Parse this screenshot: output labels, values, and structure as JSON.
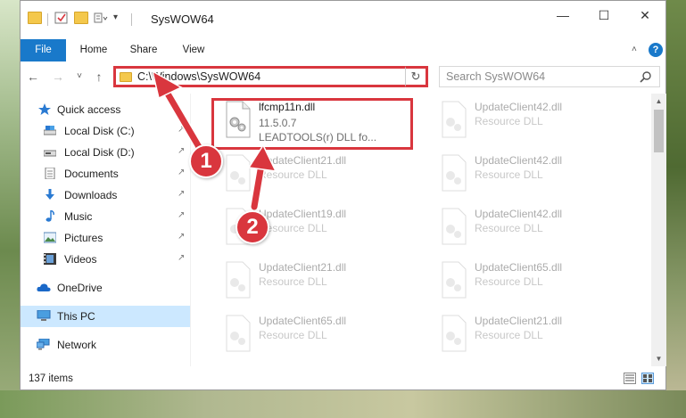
{
  "window": {
    "title": "SysWOW64",
    "minimize": "—",
    "maximize": "☐",
    "close": "✕"
  },
  "ribbon": {
    "tabs": [
      "File",
      "Home",
      "Share",
      "View"
    ],
    "expand": "˄",
    "help": "?"
  },
  "navigation": {
    "back": "←",
    "forward": "→",
    "recent": "˅",
    "up": "↑",
    "address": "C:\\Windows\\SysWOW64",
    "address_dropdown": "˅",
    "refresh": "↻",
    "search_placeholder": "Search SysWOW64"
  },
  "sidebar": {
    "items": [
      {
        "label": "Quick access",
        "icon": "star-icon",
        "pinned": false
      },
      {
        "label": "Local Disk (C:)",
        "icon": "drive-icon",
        "pinned": true
      },
      {
        "label": "Local Disk (D:)",
        "icon": "drive-icon",
        "pinned": true
      },
      {
        "label": "Documents",
        "icon": "documents-icon",
        "pinned": true
      },
      {
        "label": "Downloads",
        "icon": "download-icon",
        "pinned": true
      },
      {
        "label": "Music",
        "icon": "music-icon",
        "pinned": true
      },
      {
        "label": "Pictures",
        "icon": "pictures-icon",
        "pinned": true
      },
      {
        "label": "Videos",
        "icon": "videos-icon",
        "pinned": true
      },
      {
        "label": "OneDrive",
        "icon": "cloud-icon",
        "pinned": false
      },
      {
        "label": "This PC",
        "icon": "computer-icon",
        "pinned": false,
        "selected": true
      },
      {
        "label": "Network",
        "icon": "network-icon",
        "pinned": false
      }
    ],
    "pin_glyph": "↗"
  },
  "files": [
    {
      "name": "lfcmp11n.dll",
      "line2": "11.5.0.7",
      "line3": "LEADTOOLS(r) DLL fo...",
      "highlighted": true
    },
    {
      "name": "UpdateClient42.dll",
      "line2": "Resource DLL"
    },
    {
      "name": "UpdateClient21.dll",
      "line2": "Resource DLL"
    },
    {
      "name": "UpdateClient42.dll",
      "line2": "Resource DLL"
    },
    {
      "name": "UpdateClient19.dll",
      "line2": "Resource DLL"
    },
    {
      "name": "UpdateClient42.dll",
      "line2": "Resource DLL"
    },
    {
      "name": "UpdateClient21.dll",
      "line2": "Resource DLL"
    },
    {
      "name": "UpdateClient65.dll",
      "line2": "Resource DLL"
    },
    {
      "name": "UpdateClient65.dll",
      "line2": "Resource DLL"
    },
    {
      "name": "UpdateClient21.dll",
      "line2": "Resource DLL"
    }
  ],
  "status": {
    "item_count": "137 items"
  },
  "annotations": {
    "step1": "1",
    "step2": "2",
    "color": "#d9363e"
  },
  "colors": {
    "accent": "#1979ca",
    "selection": "#cce8ff",
    "highlight": "#d9363e"
  }
}
